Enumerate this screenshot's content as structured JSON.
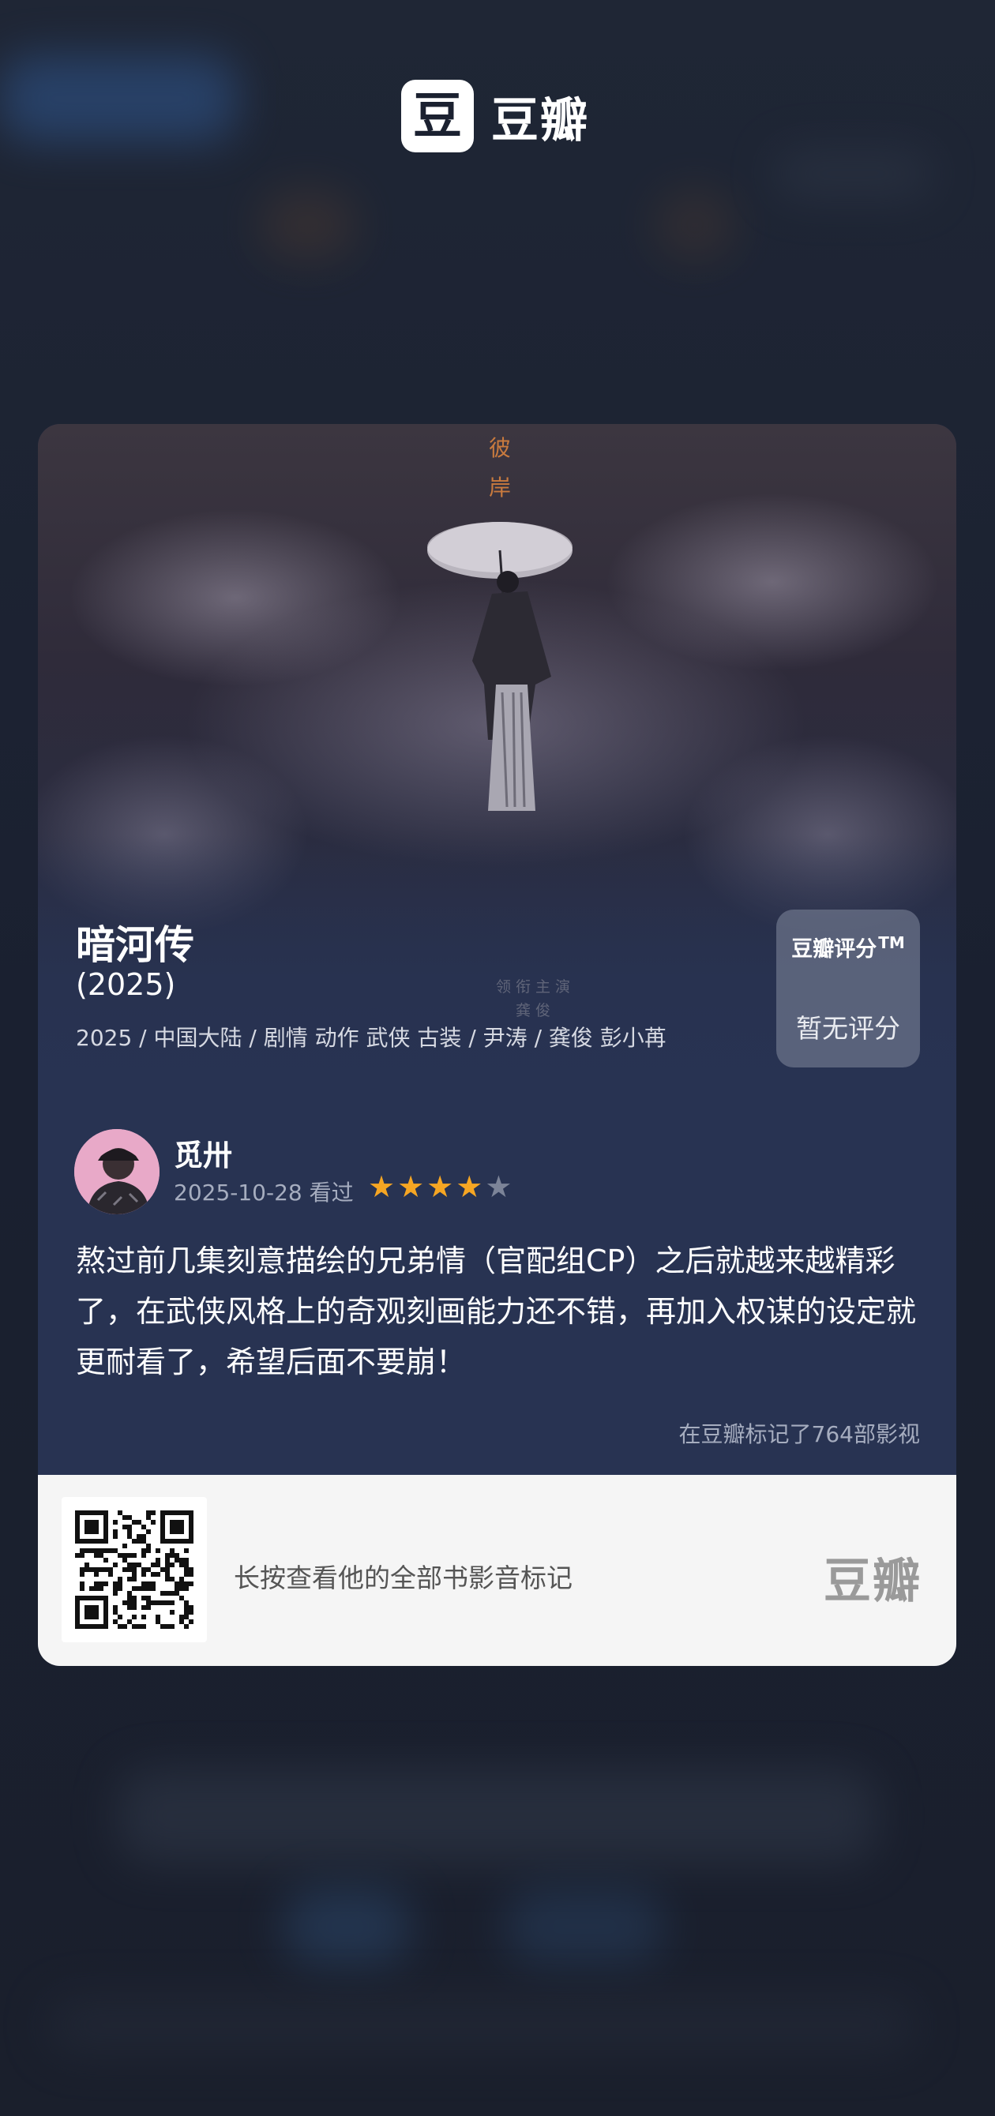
{
  "app": {
    "brand_badge": "豆",
    "brand_name": "豆瓣"
  },
  "poster": {
    "vertical_text": [
      "彼",
      "岸"
    ],
    "credit_lines": [
      "领衔主演",
      "龚俊"
    ]
  },
  "movie": {
    "title": "暗河传",
    "year": "(2025)",
    "meta": "2025 / 中国大陆 / 剧情 动作 武侠 古装 / 尹涛 / 龚俊 彭小苒"
  },
  "rating": {
    "label": "豆瓣评分",
    "tm": "TM",
    "value": "暂无评分"
  },
  "review": {
    "username": "觅卅",
    "date": "2025-10-28 看过",
    "stars": 4,
    "stars_max": 5,
    "star_color": "#f6a623",
    "text": "熬过前几集刻意描绘的兄弟情（官配组CP）之后就越来越精彩了，在武侠风格上的奇观刻画能力还不错，再加入权谋的设定就更耐看了，希望后面不要崩！",
    "marked_count": "在豆瓣标记了764部影视"
  },
  "footer": {
    "cta": "长按查看他的全部书影音标记",
    "logo": "豆瓣"
  }
}
